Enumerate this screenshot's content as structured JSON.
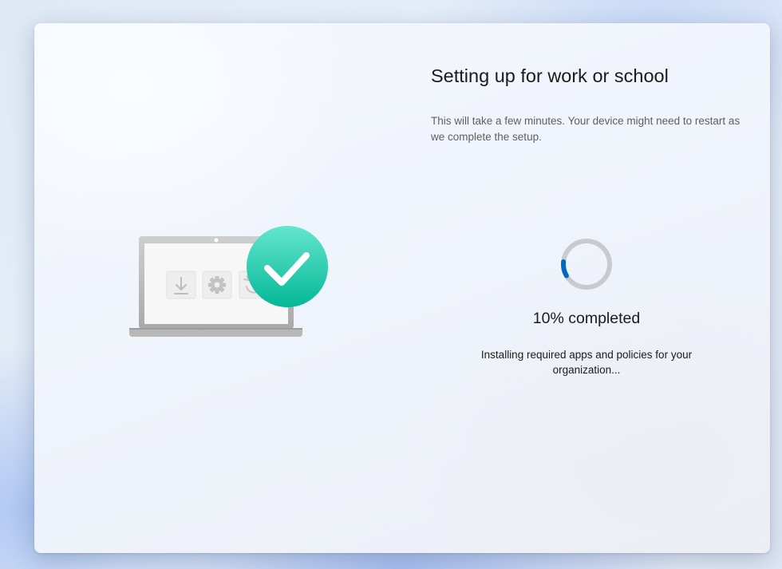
{
  "setup": {
    "title": "Setting up for work or school",
    "description": "This will take a few minutes. Your device might need to restart as we complete the setup.",
    "progress_percent": 10,
    "progress_text": "10% completed",
    "status_text": "Installing required apps and policies for your organization..."
  },
  "illustration": {
    "icons": [
      "laptop-icon",
      "download-icon",
      "gear-icon",
      "restart-icon",
      "checkmark-icon"
    ]
  },
  "colors": {
    "accent": "#0067c0",
    "spinner_track": "#c8cacd",
    "check_badge": "#1ec9a7",
    "title_text": "#1b1b1b",
    "description_text": "#5f5f5f"
  }
}
